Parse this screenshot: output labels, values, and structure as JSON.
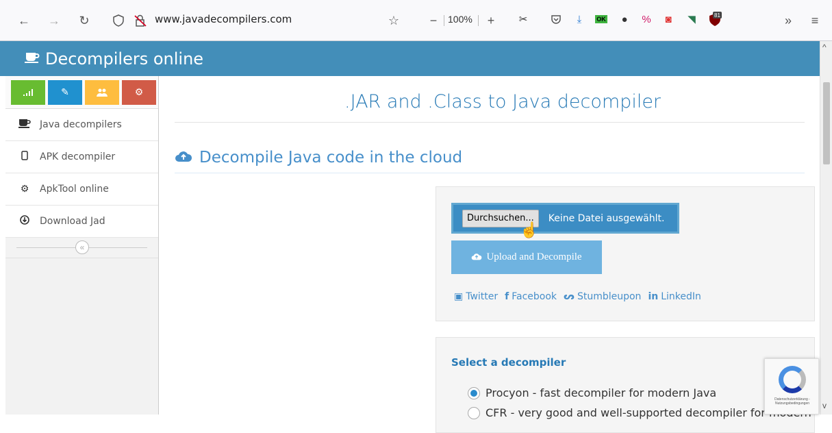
{
  "browser": {
    "url": "www.javadecompilers.com",
    "zoom": "100%",
    "badge_count": "81",
    "ext_ok": "OK"
  },
  "site": {
    "brand": "Decompilers online"
  },
  "sidebar": {
    "items": [
      {
        "label": "Java decompilers",
        "icon": "coffee-cup-icon"
      },
      {
        "label": "APK decompiler",
        "icon": "mobile-phone-icon"
      },
      {
        "label": "ApkTool online",
        "icon": "gear-icon"
      },
      {
        "label": "Download Jad",
        "icon": "download-circle-icon"
      }
    ]
  },
  "main": {
    "title": ".JAR and .Class to Java decompiler",
    "section_title": "Decompile Java code in the cloud",
    "browse_label": "Durchsuchen...",
    "file_status": "Keine Datei ausgewählt.",
    "upload_label": "Upload and Decompile",
    "share": [
      "Twitter",
      "Facebook",
      "Stumbleupon",
      "LinkedIn"
    ],
    "select_title": "Select a decompiler",
    "options": [
      {
        "label": "Procyon - fast decompiler for modern Java",
        "checked": true
      },
      {
        "label": "CFR - very good and well-supported decompiler for modern",
        "checked": false
      }
    ]
  },
  "recaptcha": {
    "text": "Datenschutzerklärung - Nutzungsbedingungen"
  },
  "colors": {
    "header": "#438eb9",
    "accent": "#478fca",
    "shortcut_green": "#68bc31",
    "shortcut_blue": "#2091cf",
    "shortcut_orange": "#febd3f",
    "shortcut_red": "#d15b47"
  }
}
